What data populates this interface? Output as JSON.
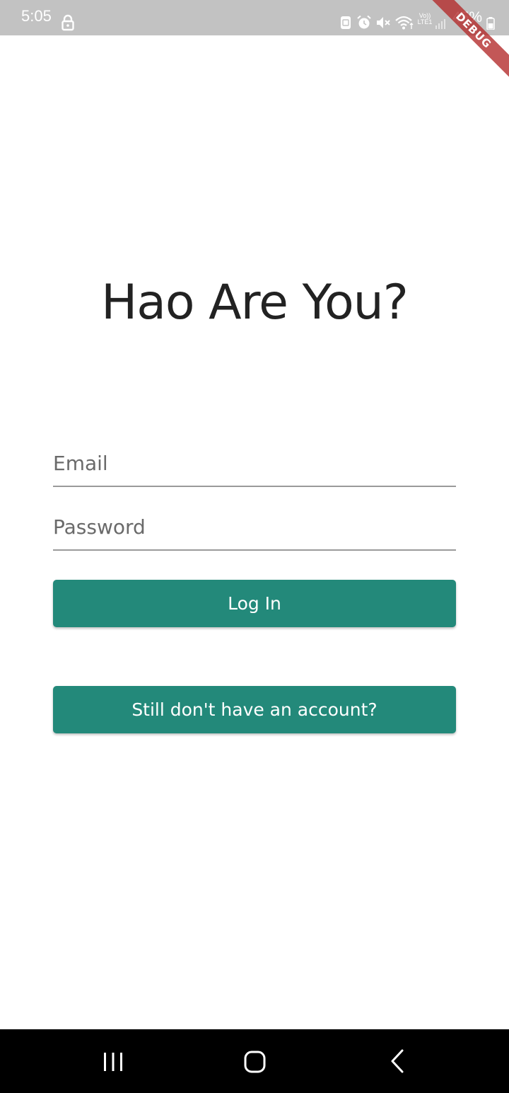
{
  "status_bar": {
    "time": "5:05",
    "battery_percent": "45%",
    "volte_top": "Vo))",
    "volte_bottom": "LTE1",
    "icons": [
      "lock-icon",
      "screenshot-icon",
      "alarm-icon",
      "mute-icon",
      "wifi-icon",
      "volte-icon",
      "signal-icon",
      "battery-icon"
    ]
  },
  "debug_banner": {
    "label": "DEBUG"
  },
  "login": {
    "title": "Hao Are You?",
    "email_placeholder": "Email",
    "email_value": "",
    "password_placeholder": "Password",
    "password_value": "",
    "login_label": "Log In",
    "signup_label": "Still don't have an account?"
  },
  "nav_bar": {
    "icons": [
      "recents-icon",
      "home-icon",
      "back-icon"
    ]
  },
  "colors": {
    "primary": "#23897a",
    "status_bar": "#c2c2c2",
    "title_text": "#222222",
    "debug_banner": "#b22828",
    "nav_bar": "#000000"
  }
}
